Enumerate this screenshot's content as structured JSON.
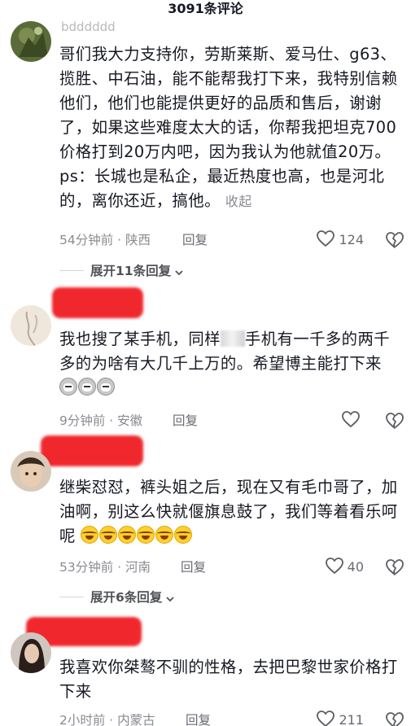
{
  "header": {
    "title": "3091条评论"
  },
  "comments": [
    {
      "username": "bdddddd",
      "text": "哥们我大力支持你，劳斯莱斯、爱马仕、g63、揽胜、中石油，能不能帮我打下来，我特别信赖他们，他们也能提供更好的品质和售后，谢谢了，如果这些难度太大的话，你帮我把坦克700价格打到20万内吧，因为我认为他就值20万。ps：长城也是私企，最近热度也高，也是河北的，离你还近，搞他。",
      "collapse_label": "收起",
      "time": "54分钟前",
      "location": "陕西",
      "reply_label": "回复",
      "likes": "124",
      "expand_label": "展开11条回复"
    },
    {
      "text_before": "我也搜了某手机，同样",
      "text_after": "手机有一千多的两千多的为啥有大几千上万的。希望博主能打下来",
      "time": "9分钟前",
      "location": "安徽",
      "reply_label": "回复",
      "likes": ""
    },
    {
      "text": "继柴怼怼，裤头姐之后，现在又有毛巾哥了，加油啊，别这么快就偃旗息鼓了，我们等着看乐呵呢",
      "time": "53分钟前",
      "location": "河南",
      "reply_label": "回复",
      "likes": "40",
      "expand_label": "展开6条回复"
    },
    {
      "text": "我喜欢你桀骜不驯的性格，去把巴黎世家价格打下来",
      "time": "2小时前",
      "location": "内蒙古",
      "reply_label": "回复",
      "likes": "211"
    }
  ],
  "icons": {
    "like": "heart-outline-icon",
    "dislike": "broken-heart-icon",
    "expand": "chevron-down-icon"
  },
  "colors": {
    "redaction": "#f0282d",
    "meta": "#8a8b91",
    "text": "#161823"
  }
}
